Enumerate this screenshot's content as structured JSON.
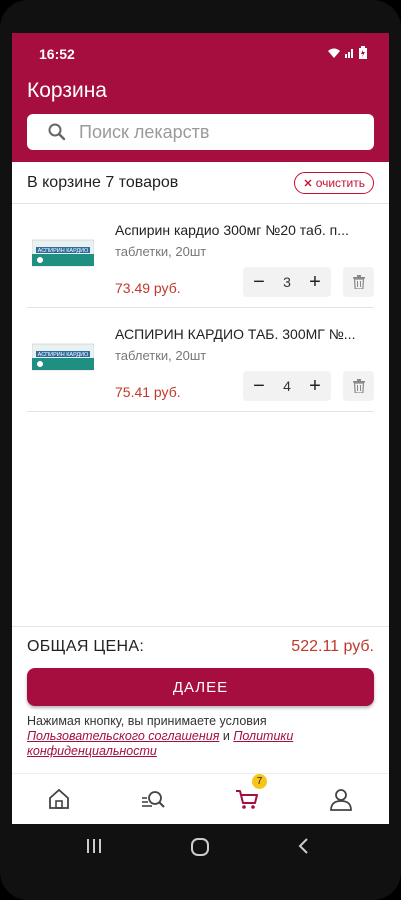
{
  "status_bar": {
    "time": "16:52"
  },
  "header": {
    "title": "Корзина"
  },
  "search": {
    "placeholder": "Поиск лекарств"
  },
  "summary": {
    "count_text": "В корзине 7 товаров",
    "clear_label": "очистить"
  },
  "items": [
    {
      "name": "Аспирин кардио 300мг №20 таб. п...",
      "subtitle": "таблетки, 20шт",
      "price": "73.49 руб.",
      "quantity": "3",
      "package_label": "АСПИРИН КАРДИО"
    },
    {
      "name": "АСПИРИН КАРДИО ТАБ. 300МГ №...",
      "subtitle": "таблетки, 20шт",
      "price": "75.41 руб.",
      "quantity": "4",
      "package_label": "АСПИРИН КАРДИО"
    }
  ],
  "totals": {
    "label": "ОБЩАЯ ЦЕНА:",
    "value": "522.11 руб."
  },
  "next_button": {
    "label": "ДАЛЕЕ"
  },
  "terms": {
    "prefix": "Нажимая кнопку, вы принимаете условия",
    "link1": "Пользовательского соглашения",
    "and": " и ",
    "link2": "Политики конфиденциальности"
  },
  "tabbar": {
    "cart_badge": "7"
  },
  "colors": {
    "brand": "#a50e3e",
    "price": "#c0392b",
    "badge": "#f5c518"
  }
}
